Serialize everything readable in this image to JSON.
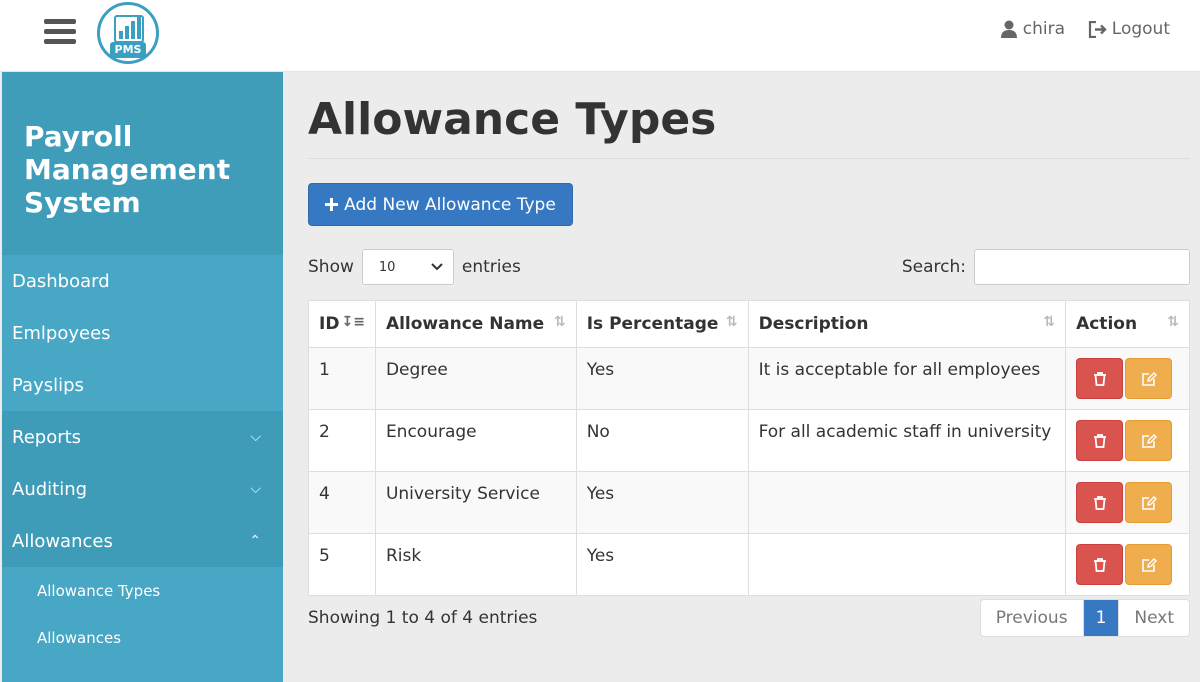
{
  "header": {
    "logo_text": "PMS",
    "user_name": "chira",
    "logout_label": "Logout"
  },
  "sidebar": {
    "brand": "Payroll Management System",
    "items": [
      {
        "label": "Dashboard"
      },
      {
        "label": "Emlpoyees"
      },
      {
        "label": "Payslips"
      },
      {
        "label": "Reports"
      },
      {
        "label": "Auditing"
      },
      {
        "label": "Allowances"
      }
    ],
    "sub_items": [
      {
        "label": "Allowance Types"
      },
      {
        "label": "Allowances"
      }
    ]
  },
  "main": {
    "title": "Allowance Types",
    "add_button": "Add New Allowance Type",
    "show_label": "Show",
    "entries_value": "10",
    "entries_label": "entries",
    "search_label": "Search:",
    "search_value": "",
    "columns": [
      "ID",
      "Allowance Name",
      "Is Percentage",
      "Description",
      "Action"
    ],
    "rows": [
      {
        "id": "1",
        "name": "Degree",
        "percentage": "Yes",
        "description": "It is acceptable for all employees"
      },
      {
        "id": "2",
        "name": "Encourage",
        "percentage": "No",
        "description": "For all academic staff in university"
      },
      {
        "id": "4",
        "name": "University Service",
        "percentage": "Yes",
        "description": ""
      },
      {
        "id": "5",
        "name": "Risk",
        "percentage": "Yes",
        "description": ""
      }
    ],
    "info": "Showing 1 to 4 of 4 entries",
    "pagination": {
      "previous": "Previous",
      "current": "1",
      "next": "Next"
    }
  },
  "colors": {
    "sidebar": "#47a7c5",
    "primary": "#3679c2",
    "danger": "#d9534f",
    "warning": "#f0ad4e"
  },
  "icons": {
    "menu": "hamburger-icon",
    "user": "user-icon",
    "logout": "logout-icon",
    "add": "plus-icon",
    "delete": "trash-icon",
    "edit": "edit-icon"
  }
}
